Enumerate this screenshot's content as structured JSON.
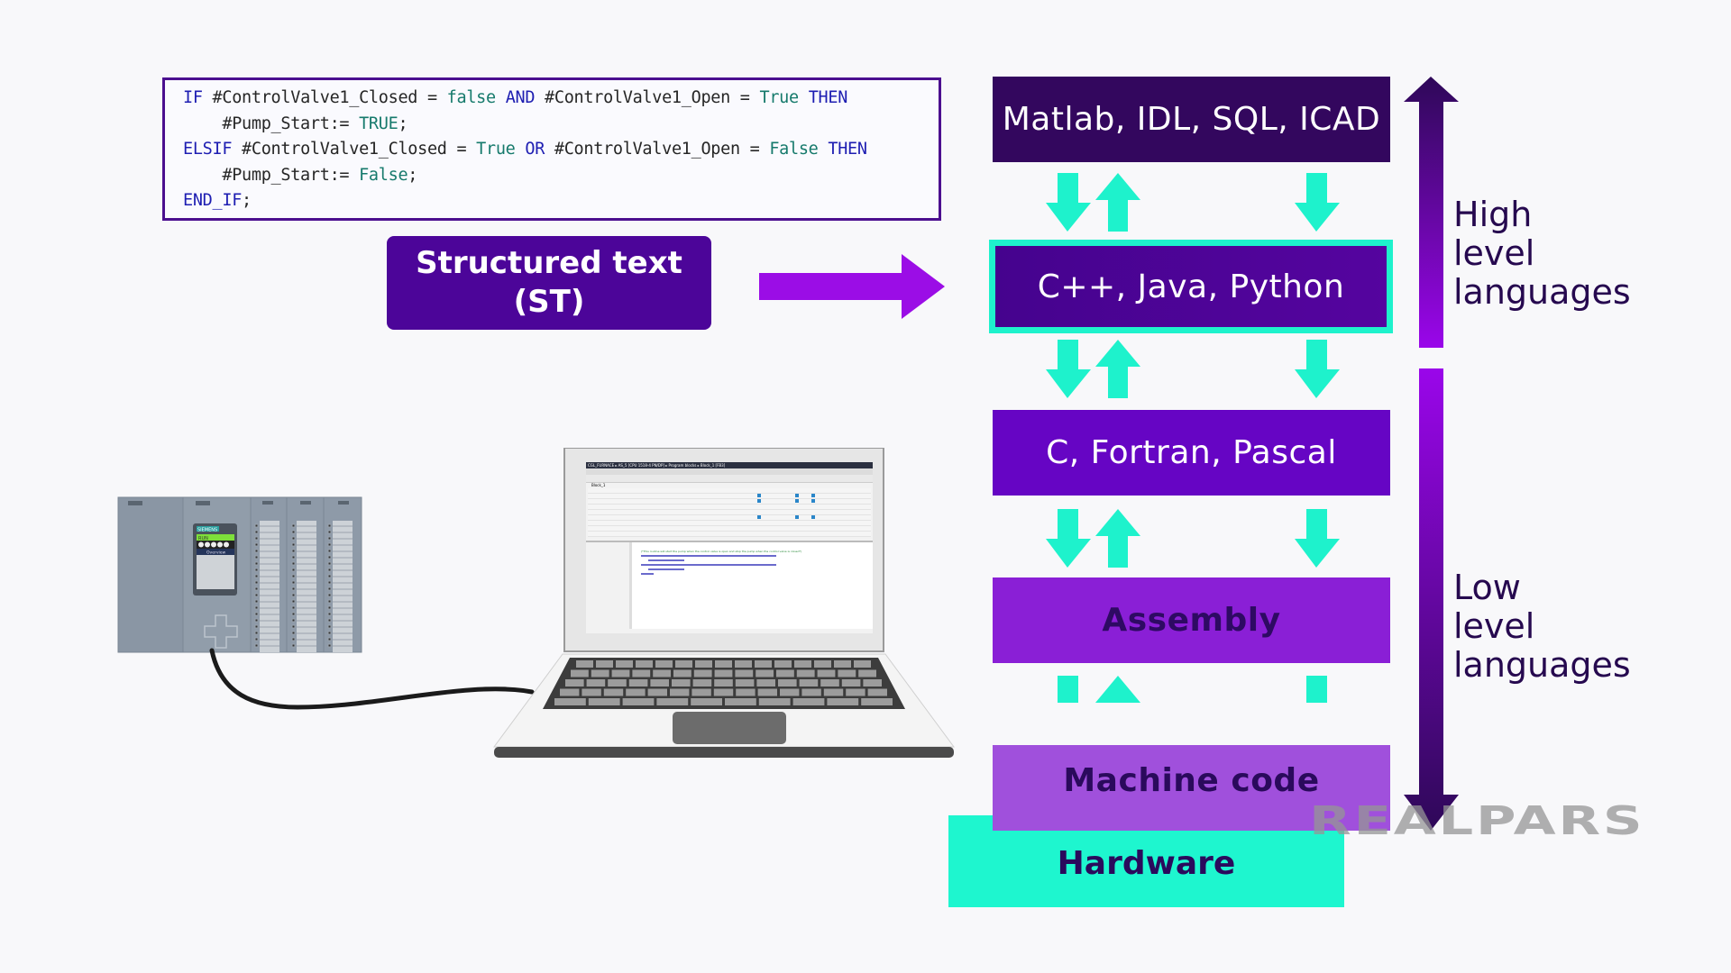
{
  "code": {
    "lines": [
      [
        {
          "t": "IF",
          "c": "kw"
        },
        {
          "t": " #ControlValve1_Closed = ",
          "c": "id"
        },
        {
          "t": "false",
          "c": "bool"
        },
        {
          "t": " ",
          "c": "id"
        },
        {
          "t": "AND",
          "c": "kw"
        },
        {
          "t": " #ControlValve1_Open = ",
          "c": "id"
        },
        {
          "t": "True",
          "c": "bool"
        },
        {
          "t": " ",
          "c": "id"
        },
        {
          "t": "THEN",
          "c": "kw"
        }
      ],
      [
        {
          "t": "    #Pump_Start:= ",
          "c": "id"
        },
        {
          "t": "TRUE",
          "c": "bool"
        },
        {
          "t": ";",
          "c": "id"
        }
      ],
      [
        {
          "t": "ELSIF",
          "c": "kw"
        },
        {
          "t": " #ControlValve1_Closed = ",
          "c": "id"
        },
        {
          "t": "True",
          "c": "bool"
        },
        {
          "t": " ",
          "c": "id"
        },
        {
          "t": "OR",
          "c": "kw"
        },
        {
          "t": " #ControlValve1_Open = ",
          "c": "id"
        },
        {
          "t": "False",
          "c": "bool"
        },
        {
          "t": " ",
          "c": "id"
        },
        {
          "t": "THEN",
          "c": "kw"
        }
      ],
      [
        {
          "t": "    #Pump_Start:= ",
          "c": "id"
        },
        {
          "t": "False",
          "c": "bool"
        },
        {
          "t": ";",
          "c": "id"
        }
      ],
      [
        {
          "t": "END_IF",
          "c": "kw"
        },
        {
          "t": ";",
          "c": "id"
        }
      ]
    ]
  },
  "st_label": {
    "line1": "Structured text",
    "line2": "(ST)"
  },
  "levels": [
    {
      "label": "Matlab, IDL, SQL, ICAD"
    },
    {
      "label": "C++, Java, Python",
      "highlighted": true
    },
    {
      "label": "C, Fortran, Pascal"
    },
    {
      "label": "Assembly"
    },
    {
      "label": "Machine code"
    }
  ],
  "hardware": "Hardware",
  "high_label": [
    "High",
    "level",
    "languages"
  ],
  "low_label": [
    "Low",
    "level",
    "languages"
  ],
  "logo": "REALPARS",
  "plc": {
    "brand": "SIEMENS",
    "status": "RUN",
    "screen": "Overview"
  },
  "laptop_screen": {
    "breadcrumb": "CGL_FURNACE ▸ AS_5 [CPU 1518-4 PN/DP] ▸ Program blocks ▸ Block_1 [FB3]",
    "block_name": "Block_1",
    "comment": "(*This routine will start the pump when the control valve is open and stop the pump when the control valve is closed*)"
  },
  "colors": {
    "accent_teal": "#1ef2cc",
    "dark_purple": "#33075e",
    "st_purple": "#4c0599",
    "arrow_magenta": "#9b0de6"
  }
}
